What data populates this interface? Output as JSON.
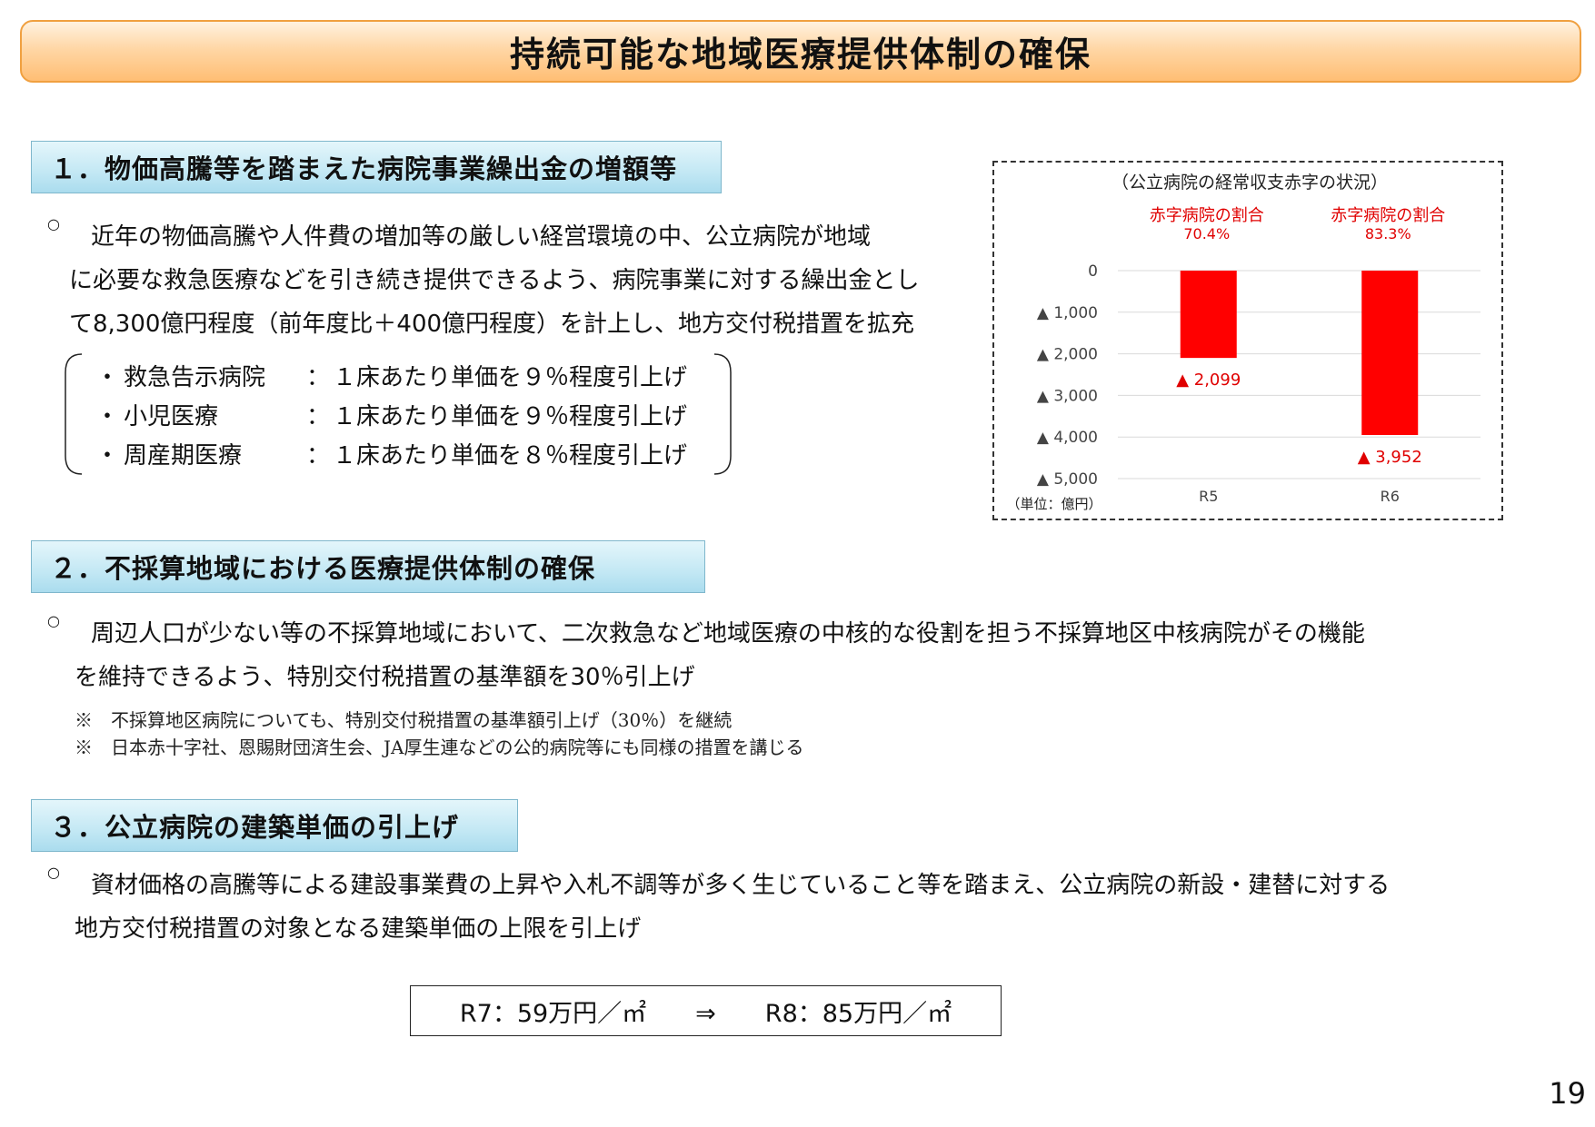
{
  "page_title": "持続可能な地域医療提供体制の確保",
  "section1": {
    "heading": "１．物価高騰等を踏まえた病院事業繰出金の増額等",
    "bullet": "○",
    "lines": [
      "近年の物価高騰や人件費の増加等の厳しい経営環境の中、公立病院が地域",
      "に必要な救急医療などを引き続き提供できるよう、病院事業に対する繰出金とし",
      "て8,300億円程度（前年度比＋400億円程度）を計上し、地方交付税措置を拡充"
    ],
    "items": [
      {
        "dot": "・",
        "label": "救急告示病院",
        "colon": "：",
        "value": "１床あたり単価を９％程度引上げ"
      },
      {
        "dot": "・",
        "label": "小児医療",
        "colon": "：",
        "value": "１床あたり単価を９％程度引上げ"
      },
      {
        "dot": "・",
        "label": "周産期医療",
        "colon": "：",
        "value": "１床あたり単価を８％程度引上げ"
      }
    ]
  },
  "section2": {
    "heading": "２．不採算地域における医療提供体制の確保",
    "bullet": "○",
    "lines": [
      "周辺人口が少ない等の不採算地域において、二次救急など地域医療の中核的な役割を担う不採算地区中核病院がその機能",
      "を維持できるよう、特別交付税措置の基準額を30％引上げ"
    ],
    "notes": [
      "※　不採算地区病院についても、特別交付税措置の基準額引上げ（30％）を継続",
      "※　日本赤十字社、恩賜財団済生会、JA厚生連などの公的病院等にも同様の措置を講じる"
    ]
  },
  "section3": {
    "heading": "３．公立病院の建築単価の引上げ",
    "bullet": "○",
    "lines": [
      "資材価格の高騰等による建設事業費の上昇や入札不調等が多く生じていること等を踏まえ、公立病院の新設・建替に対する",
      "地方交付税措置の対象となる建築単価の上限を引上げ"
    ],
    "range_text": "R7：59万円／㎡　　⇒　　R8：85万円／㎡"
  },
  "page_number": "19",
  "chart_data": {
    "type": "bar",
    "title": "（公立病院の経常収支赤字の状況）",
    "unit_label": "（単位：億円）",
    "categories": [
      "R5",
      "R6"
    ],
    "values": [
      -2099,
      -3952
    ],
    "value_labels": [
      "▲ 2,099",
      "▲ 3,952"
    ],
    "ratio_labels": [
      {
        "title": "赤字病院の割合",
        "value": "70.4%"
      },
      {
        "title": "赤字病院の割合",
        "value": "83.3%"
      }
    ],
    "ylim": [
      -5000,
      0
    ],
    "yticks": [
      0,
      -1000,
      -2000,
      -3000,
      -4000,
      -5000
    ],
    "ytick_labels": [
      "0",
      "▲ 1,000",
      "▲ 2,000",
      "▲ 3,000",
      "▲ 4,000",
      "▲ 5,000"
    ],
    "grid": true,
    "bar_color": "#ff0000",
    "label_color": "#e00000",
    "tick_triangle_color": "#333333"
  }
}
